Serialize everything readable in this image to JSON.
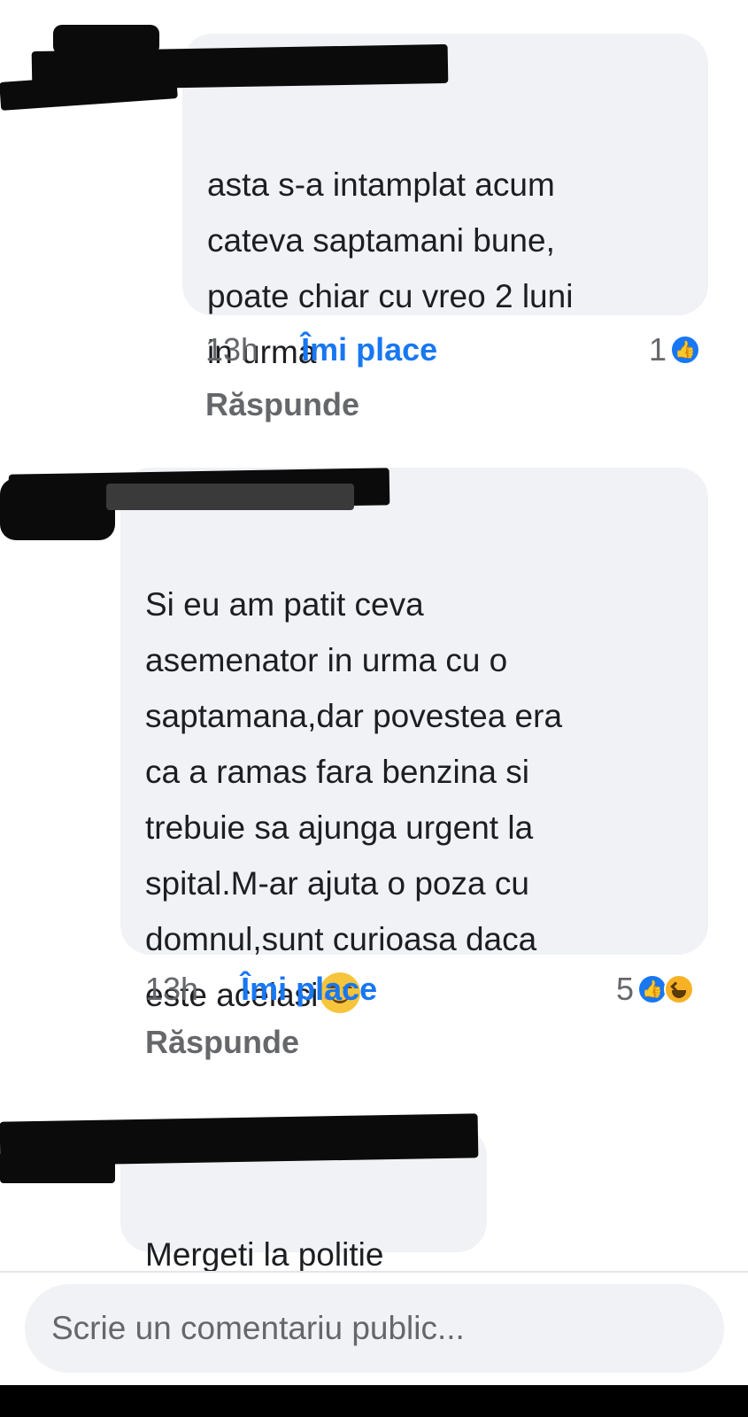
{
  "comments": [
    {
      "text": "asta s-a intamplat acum\ncateva saptamani bune,\npoate chiar cu vreo 2 luni\nin urma",
      "time": "13h",
      "like_label": "Îmi place",
      "reply_label": "Răspunde",
      "reaction_count": "1",
      "reactions": [
        "like-icon"
      ]
    },
    {
      "text": "Si eu am patit ceva\nasemenator in urma cu o\nsaptamana,dar povestea era\nca a ramas fara benzina si\ntrebuie sa ajunga urgent la\nspital.M-ar ajuta o poza cu\ndomnul,sunt curioasa daca\neste acelasi",
      "emoji": "smiling-face-icon",
      "time": "13h",
      "like_label": "Îmi place",
      "reply_label": "Răspunde",
      "reaction_count": "5",
      "reactions": [
        "like-icon",
        "haha-icon"
      ]
    },
    {
      "text": "Mergeti la politie"
    }
  ],
  "composer": {
    "placeholder": "Scrie un comentariu public..."
  },
  "colors": {
    "bubble": "#f0f2f5",
    "accent": "#1877f2",
    "muted": "#65676b",
    "text": "#1c1e21"
  }
}
